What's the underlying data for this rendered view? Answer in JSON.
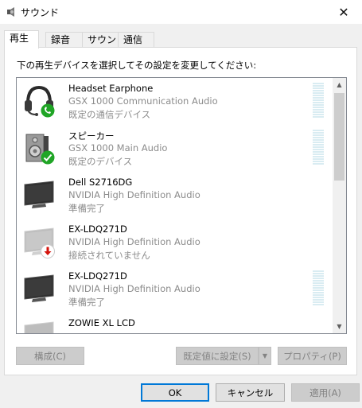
{
  "window": {
    "title": "サウンド",
    "close_glyph": "✕"
  },
  "tabs": [
    {
      "label": "再生",
      "active": true
    },
    {
      "label": "録音",
      "active": false
    },
    {
      "label": "サウンド",
      "active": false
    },
    {
      "label": "通信",
      "active": false
    }
  ],
  "instruction": "下の再生デバイスを選択してその設定を変更してください:",
  "devices": [
    {
      "name": "Headset Earphone",
      "driver": "GSX 1000 Communication Audio",
      "status": "既定の通信デバイス",
      "icon": "headset-icon",
      "badge": "phone-badge-icon"
    },
    {
      "name": "スピーカー",
      "driver": "GSX 1000 Main Audio",
      "status": "既定のデバイス",
      "icon": "speaker-icon",
      "badge": "check-badge-icon"
    },
    {
      "name": "Dell S2716DG",
      "driver": "NVIDIA High Definition Audio",
      "status": "準備完了",
      "icon": "monitor-icon",
      "badge": ""
    },
    {
      "name": "EX-LDQ271D",
      "driver": "NVIDIA High Definition Audio",
      "status": "接続されていません",
      "icon": "monitor-disconnected-icon",
      "badge": "down-arrow-badge-icon"
    },
    {
      "name": "EX-LDQ271D",
      "driver": "NVIDIA High Definition Audio",
      "status": "準備完了",
      "icon": "monitor-icon",
      "badge": ""
    },
    {
      "name": "ZOWIE XL LCD",
      "driver": "",
      "status": "",
      "icon": "monitor-icon",
      "badge": ""
    }
  ],
  "buttons": {
    "configure": "構成(C)",
    "set_default": "既定値に設定(S)",
    "properties": "プロパティ(P)",
    "ok": "OK",
    "cancel": "キャンセル",
    "apply": "適用(A)"
  },
  "colors": {
    "accent": "#0078d7",
    "check_green": "#20a526",
    "red_badge": "#d4140c",
    "meter": "#d9ecf2"
  }
}
